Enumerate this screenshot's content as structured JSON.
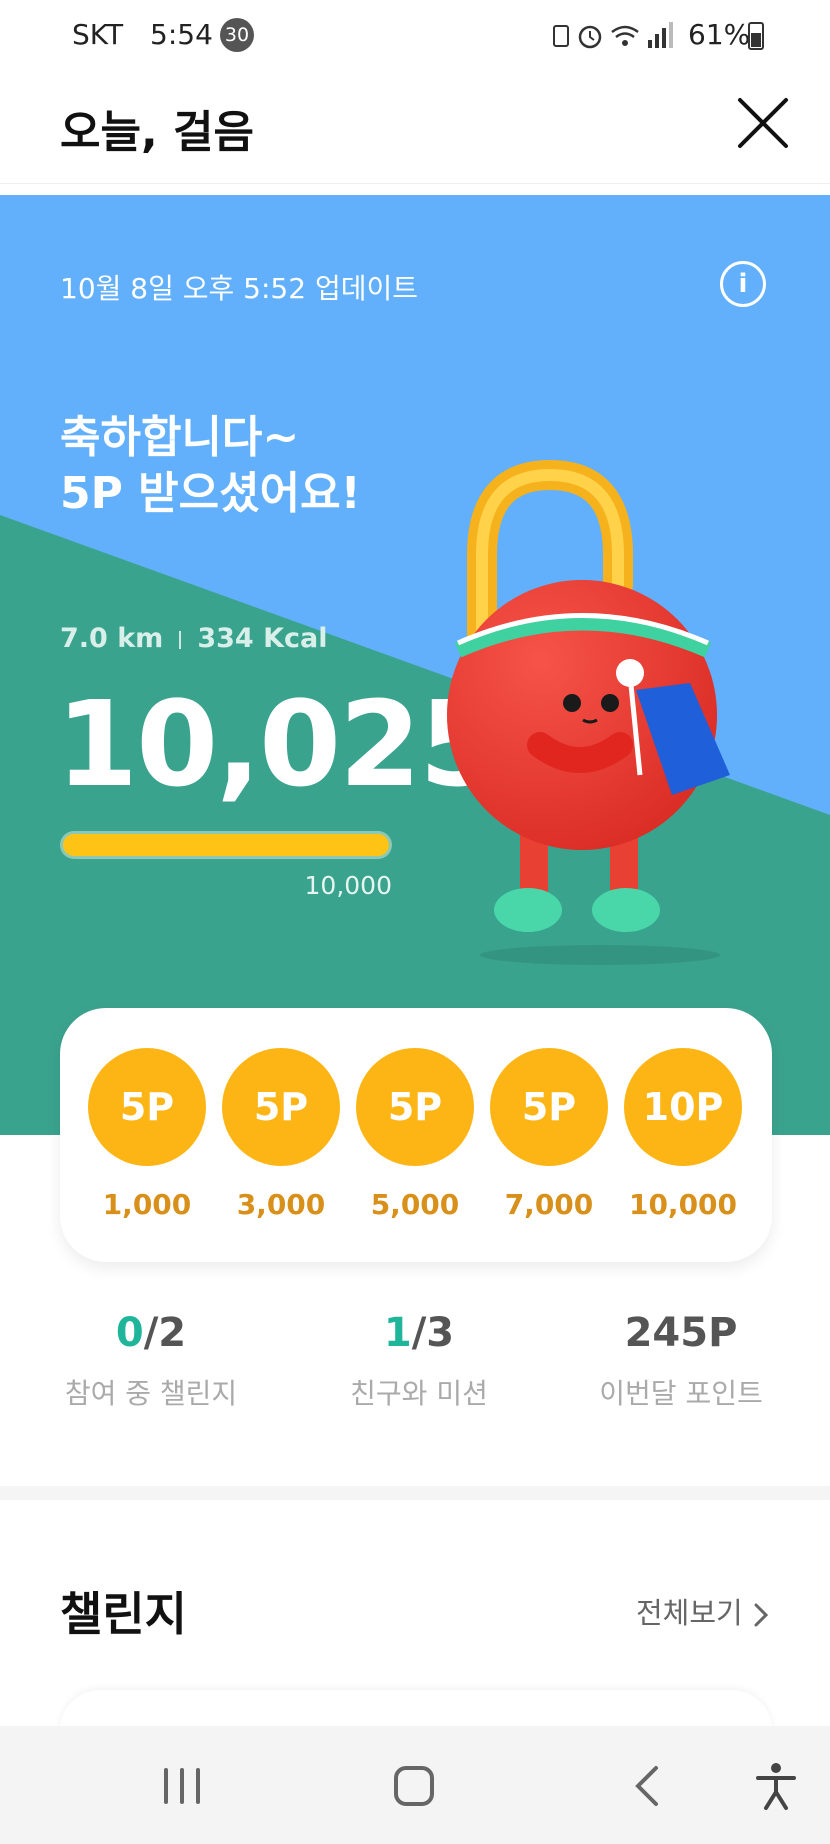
{
  "status_bar": {
    "carrier": "SKT",
    "time": "5:54",
    "notification_count": "30",
    "battery": "61%"
  },
  "header": {
    "title": "오늘, 걸음"
  },
  "hero": {
    "update_text": "10월 8일 오후 5:52 업데이트",
    "info_label": "i",
    "congrats_line1": "축하합니다~",
    "congrats_line2": "5P 받으셨어요!",
    "distance": "7.0 km",
    "calories": "334 Kcal",
    "steps": "10,025",
    "goal": "10,000",
    "progress": 1.0
  },
  "rewards": [
    {
      "points": "5P",
      "steps": "1,000"
    },
    {
      "points": "5P",
      "steps": "3,000"
    },
    {
      "points": "5P",
      "steps": "5,000"
    },
    {
      "points": "5P",
      "steps": "7,000"
    },
    {
      "points": "10P",
      "steps": "10,000"
    }
  ],
  "summary": {
    "challenges": {
      "current": "0",
      "total": "/2",
      "label": "참여 중 챌린지"
    },
    "missions": {
      "current": "1",
      "total": "/3",
      "label": "친구와 미션"
    },
    "points": {
      "value": "245P",
      "label": "이번달 포인트"
    }
  },
  "challenge_section": {
    "title": "챌린지",
    "see_all": "전체보기"
  },
  "colors": {
    "sky": "#62b0fb",
    "green": "#3aa38e",
    "coin": "#fdb515",
    "accent": "#1fb59b"
  },
  "icons": [
    "close-icon",
    "info-icon",
    "chevron-right-icon",
    "recent-apps-icon",
    "home-icon",
    "back-icon",
    "accessibility-icon"
  ]
}
